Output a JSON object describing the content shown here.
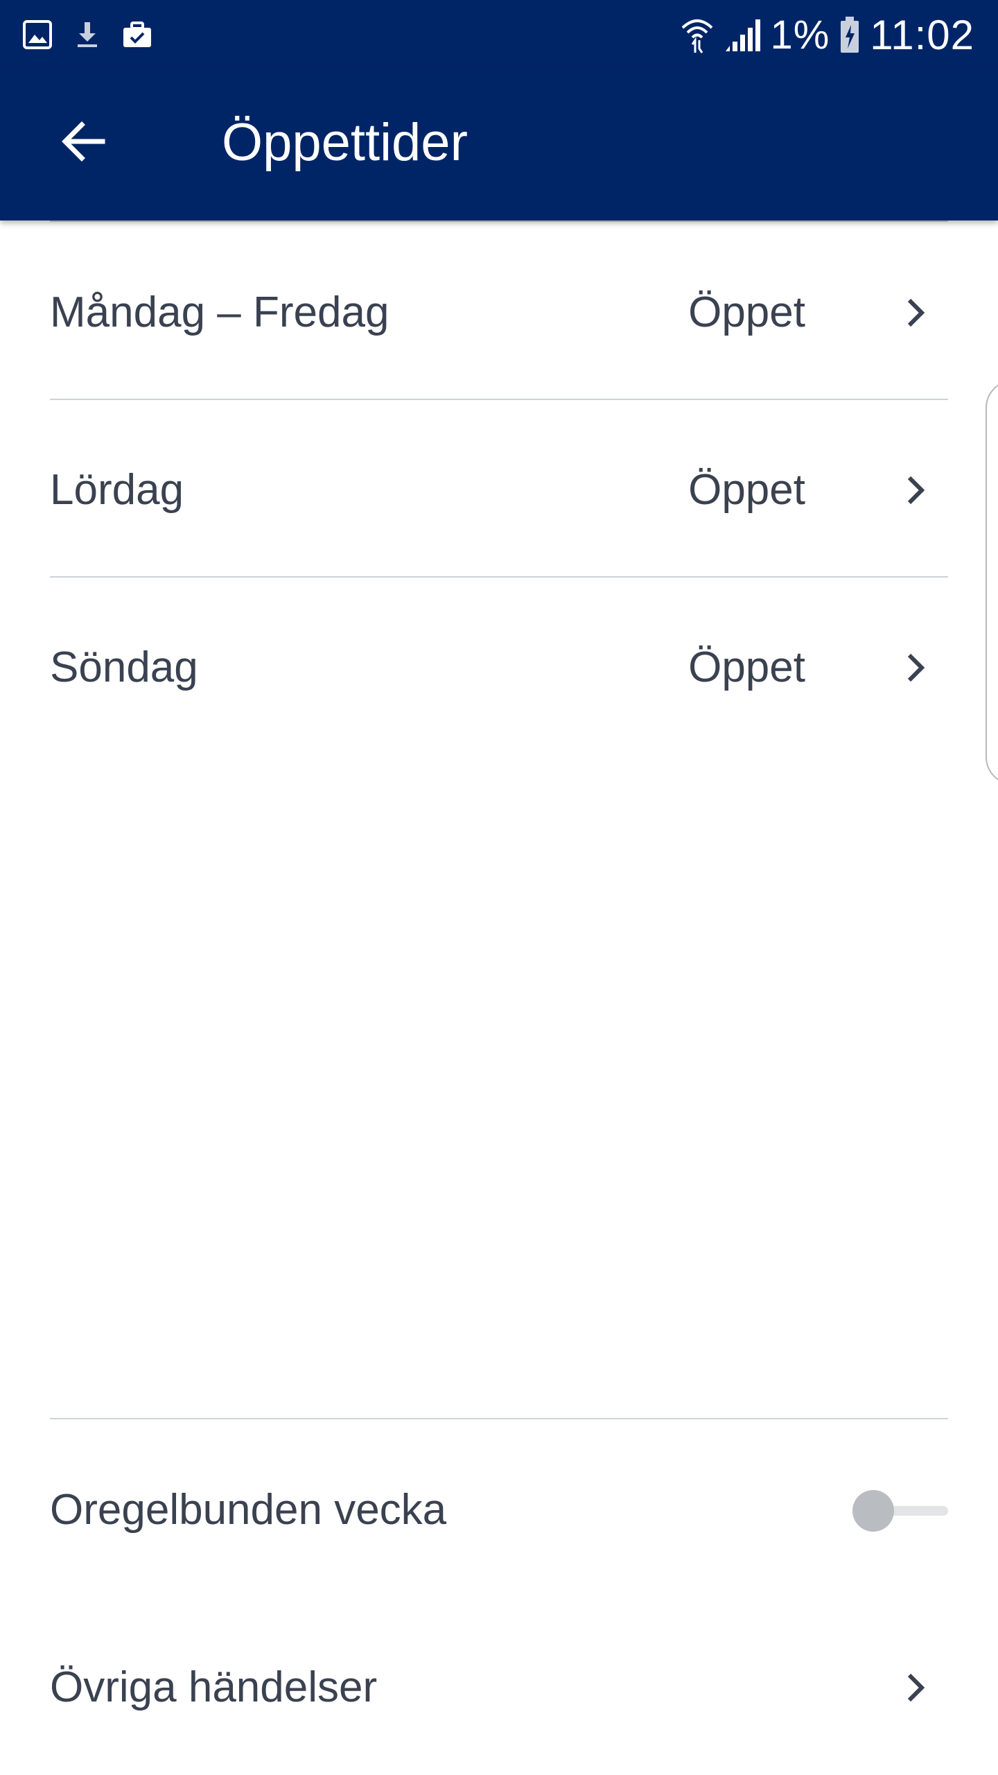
{
  "status_bar": {
    "left_icons": [
      "gallery-icon",
      "download-icon",
      "briefcase-check-icon"
    ],
    "right_icons": [
      "wifi-icon",
      "signal-icon",
      "battery-charging-icon"
    ],
    "battery": "1%",
    "time": "11:02"
  },
  "app_bar": {
    "back_icon": "arrow-left-icon",
    "title": "Öppettider"
  },
  "schedule": {
    "rows": [
      {
        "label": "Måndag – Fredag",
        "value": "Öppet",
        "icon": "chevron-right-icon"
      },
      {
        "label": "Lördag",
        "value": "Öppet",
        "icon": "chevron-right-icon"
      },
      {
        "label": "Söndag",
        "value": "Öppet",
        "icon": "chevron-right-icon"
      }
    ]
  },
  "irregular_week": {
    "label": "Oregelbunden vecka",
    "enabled": false
  },
  "other_events": {
    "label": "Övriga händelser",
    "icon": "chevron-right-icon"
  },
  "colors": {
    "header": "#002566",
    "text": "#3a4150",
    "divider": "#cfd2d6",
    "toggle_thumb": "#b9bcc1",
    "toggle_track": "#e3e4e6"
  }
}
